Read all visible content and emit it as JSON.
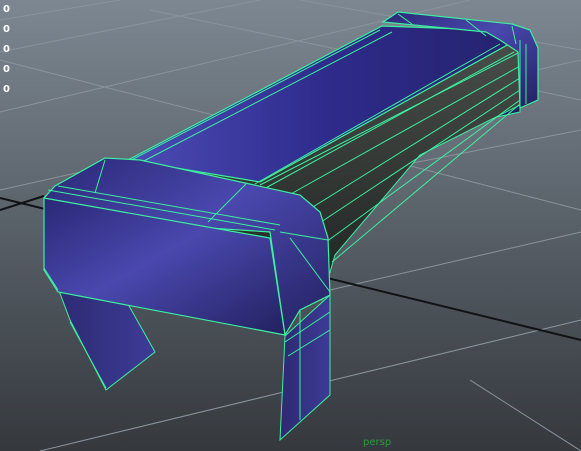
{
  "viewport": {
    "camera_label": "persp",
    "hud_values": [
      "0",
      "0",
      "0",
      "0",
      "0"
    ]
  },
  "scene": {
    "object": "bench-model",
    "wireframe_color": "#3cf0a0",
    "material_color": "#2a2770",
    "underside_color": "#2b3230",
    "grid_color": "#8a939c",
    "grid_axis_color": "#101215"
  }
}
